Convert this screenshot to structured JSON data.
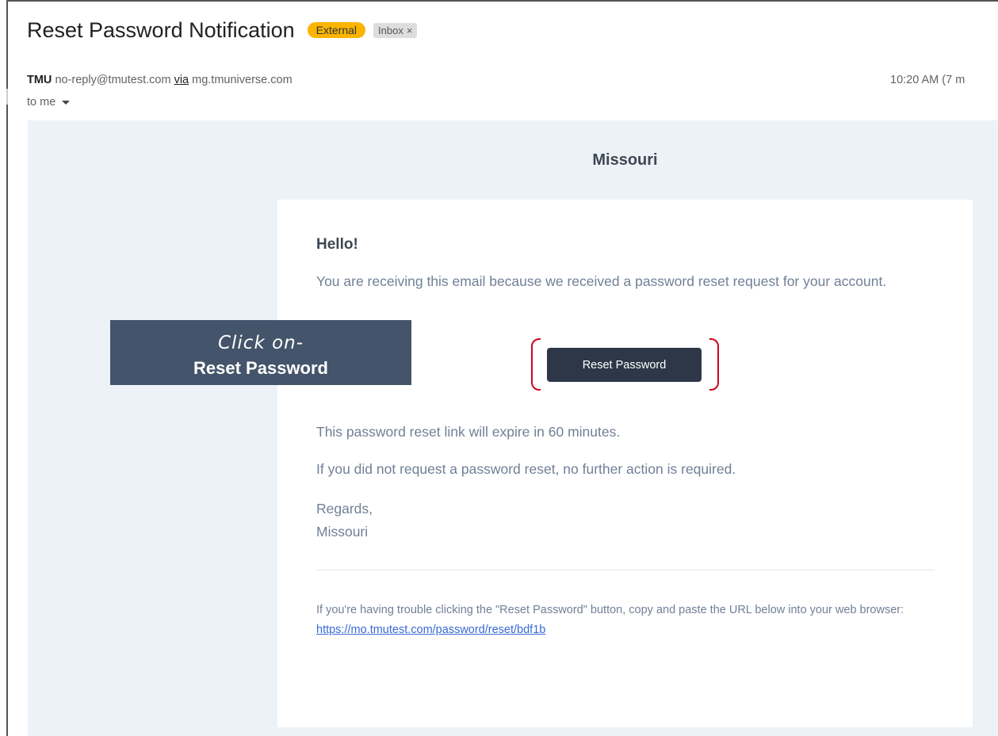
{
  "header": {
    "subject": "Reset Password Notification",
    "badge_external": "External",
    "badge_inbox": "Inbox",
    "badge_inbox_close": "×",
    "sender_name": "TMU",
    "sender_email": "no-reply@tmutest.com",
    "via_label": "via",
    "via_domain": "mg.tmuniverse.com",
    "to_label": "to me",
    "time": "10:20 AM (7 m"
  },
  "email": {
    "org_title": "Missouri",
    "greeting": "Hello!",
    "intro": "You are receiving this email because we received a password reset request for your account.",
    "button_label": "Reset Password",
    "expire_text": "This password reset link will expire in 60 minutes.",
    "no_action_text": "If you did not request a password reset, no further action is required.",
    "regards": "Regards,",
    "signature": "Missouri",
    "trouble_text": "If you're having trouble clicking the \"Reset Password\" button, copy and paste the URL below into your web browser:",
    "reset_url": "https://mo.tmutest.com/password/reset/bdf1b"
  },
  "callout": {
    "line1": "Click on-",
    "line2": "Reset Password"
  },
  "colors": {
    "button_bg": "#2d3748",
    "badge_external": "#f9b500",
    "callout_bg": "#44546a",
    "highlight_bracket": "#d0021b",
    "link": "#3869d4"
  }
}
